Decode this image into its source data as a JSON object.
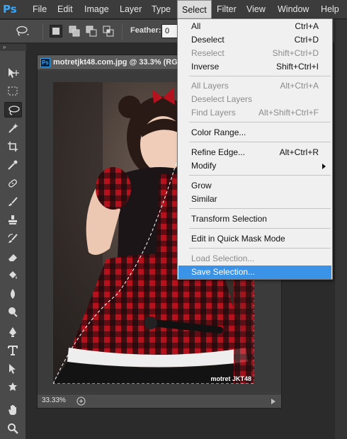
{
  "app": {
    "logo": "Ps"
  },
  "menubar": {
    "items": [
      "File",
      "Edit",
      "Image",
      "Layer",
      "Type",
      "Select",
      "Filter",
      "View",
      "Window",
      "Help"
    ],
    "active": "Select"
  },
  "options": {
    "feather_label": "Feather:",
    "feather_value": "0 px"
  },
  "document": {
    "title": "motretjkt48.com.jpg @ 33.3% (RG",
    "ps_badge": "Ps",
    "zoom": "33.33%",
    "watermark": "motret JKT48"
  },
  "select_menu": {
    "items": [
      {
        "label": "All",
        "shortcut": "Ctrl+A",
        "enabled": true
      },
      {
        "label": "Deselect",
        "shortcut": "Ctrl+D",
        "enabled": true
      },
      {
        "label": "Reselect",
        "shortcut": "Shift+Ctrl+D",
        "enabled": false
      },
      {
        "label": "Inverse",
        "shortcut": "Shift+Ctrl+I",
        "enabled": true
      },
      {
        "label": "All Layers",
        "shortcut": "Alt+Ctrl+A",
        "enabled": false
      },
      {
        "label": "Deselect Layers",
        "shortcut": "",
        "enabled": false
      },
      {
        "label": "Find Layers",
        "shortcut": "Alt+Shift+Ctrl+F",
        "enabled": false
      },
      {
        "label": "Color Range...",
        "shortcut": "",
        "enabled": true
      },
      {
        "label": "Refine Edge...",
        "shortcut": "Alt+Ctrl+R",
        "enabled": true
      },
      {
        "label": "Modify",
        "shortcut": "",
        "enabled": true,
        "submenu": true
      },
      {
        "label": "Grow",
        "shortcut": "",
        "enabled": true
      },
      {
        "label": "Similar",
        "shortcut": "",
        "enabled": true
      },
      {
        "label": "Transform Selection",
        "shortcut": "",
        "enabled": true
      },
      {
        "label": "Edit in Quick Mask Mode",
        "shortcut": "",
        "enabled": true
      },
      {
        "label": "Load Selection...",
        "shortcut": "",
        "enabled": false
      },
      {
        "label": "Save Selection...",
        "shortcut": "",
        "enabled": true,
        "highlighted": true
      }
    ]
  },
  "toolbar": {
    "tools": [
      "move-tool",
      "marquee-tool",
      "lasso-tool",
      "magic-wand-tool",
      "crop-tool",
      "eyedropper-tool",
      "healing-brush-tool",
      "brush-tool",
      "clone-stamp-tool",
      "history-brush-tool",
      "eraser-tool",
      "paint-bucket-tool",
      "blur-tool",
      "dodge-tool",
      "pen-tool",
      "type-tool",
      "path-selection-tool",
      "shape-tool",
      "hand-tool",
      "zoom-tool"
    ],
    "selected": "lasso-tool"
  },
  "colors": {
    "accent": "#3a93e6",
    "logo": "#31a8ff"
  }
}
